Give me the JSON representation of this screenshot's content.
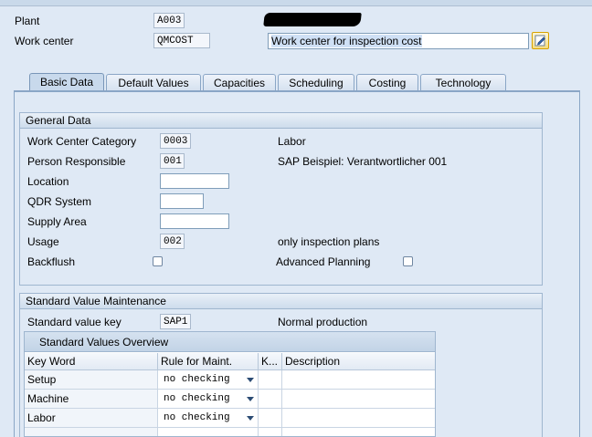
{
  "header": {
    "plant_label": "Plant",
    "plant_value": "A003",
    "work_center_label": "Work center",
    "work_center_value": "QMCOST",
    "work_center_desc": "Work center for inspection cost"
  },
  "tabs": [
    {
      "label": "Basic Data",
      "active": true
    },
    {
      "label": "Default Values"
    },
    {
      "label": "Capacities"
    },
    {
      "label": "Scheduling"
    },
    {
      "label": "Costing"
    },
    {
      "label": "Technology"
    }
  ],
  "general_data": {
    "title": "General Data",
    "category_label": "Work Center Category",
    "category_value": "0003",
    "category_text": "Labor",
    "person_label": "Person Responsible",
    "person_value": "001",
    "person_text": "SAP Beispiel: Verantwortlicher 001",
    "location_label": "Location",
    "location_value": "",
    "qdr_label": "QDR System",
    "qdr_value": "",
    "supply_label": "Supply Area",
    "supply_value": "",
    "usage_label": "Usage",
    "usage_value": "002",
    "usage_text": "only inspection plans",
    "backflush_label": "Backflush",
    "adv_planning_label": "Advanced Planning"
  },
  "std_value": {
    "title": "Standard Value Maintenance",
    "key_label": "Standard value key",
    "key_value": "SAP1",
    "key_text": "Normal production",
    "overview_title": "Standard Values Overview",
    "columns": [
      "Key Word",
      "Rule for Maint.",
      "K...",
      "Description"
    ],
    "rows": [
      {
        "keyword": "Setup",
        "rule": "no checking",
        "k": "",
        "desc": ""
      },
      {
        "keyword": "Machine",
        "rule": "no checking",
        "k": "",
        "desc": ""
      },
      {
        "keyword": "Labor",
        "rule": "no checking",
        "k": "",
        "desc": ""
      }
    ]
  },
  "icons": {
    "edit": "edit-pencil-icon",
    "column_config": "table-settings-icon"
  }
}
